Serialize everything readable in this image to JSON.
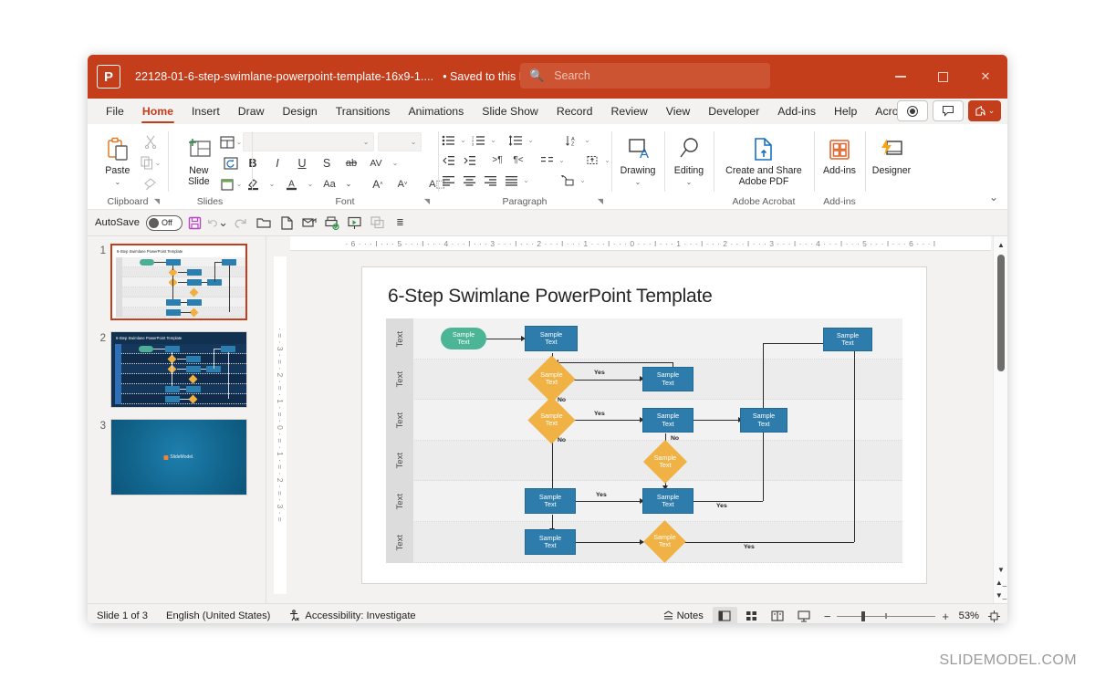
{
  "window": {
    "app_icon": "powerpoint-logo-icon",
    "document_title": "22128-01-6-step-swimlane-powerpoint-template-16x9-1....",
    "save_state": "• Saved to this PC",
    "save_state_chevron": "⌄",
    "search_placeholder": "Search",
    "search_value": "",
    "minimize_label": "–",
    "maximize_label": "□",
    "close_label": "✕"
  },
  "ribbon_tabs": [
    {
      "label": "File",
      "active": false
    },
    {
      "label": "Home",
      "active": true
    },
    {
      "label": "Insert",
      "active": false
    },
    {
      "label": "Draw",
      "active": false
    },
    {
      "label": "Design",
      "active": false
    },
    {
      "label": "Transitions",
      "active": false
    },
    {
      "label": "Animations",
      "active": false
    },
    {
      "label": "Slide Show",
      "active": false
    },
    {
      "label": "Record",
      "active": false
    },
    {
      "label": "Review",
      "active": false
    },
    {
      "label": "View",
      "active": false
    },
    {
      "label": "Developer",
      "active": false
    },
    {
      "label": "Add-ins",
      "active": false
    },
    {
      "label": "Help",
      "active": false
    },
    {
      "label": "Acrobat",
      "active": false
    }
  ],
  "tabbar_right": {
    "record_button": "⏺",
    "comments_button": "💬",
    "share_button": "Share",
    "share_chevron": "⌄"
  },
  "ribbon_groups": {
    "clipboard": {
      "label": "Clipboard",
      "paste_label": "Paste",
      "paste_chevron": "⌄",
      "cut_label": "Cut",
      "copy_label": "Copy",
      "format_painter_label": "Format Painter",
      "dialog_launcher": "⌐"
    },
    "slides": {
      "label": "Slides",
      "new_slide_label": "New Slide",
      "new_slide_chevron": "⌄",
      "layout_label": "Layout",
      "reset_label": "Reset",
      "section_label": "Section"
    },
    "font": {
      "label": "Font",
      "font_name_value": "",
      "font_size_value": "",
      "bold": "B",
      "italic": "I",
      "underline": "U",
      "shadow": "S",
      "strikethrough": "ab",
      "character_spacing": "AV",
      "text_highlight": "Highlight",
      "font_color": "A",
      "change_case": "Aa",
      "increase_size": "A",
      "decrease_size": "A",
      "clear_formatting": "A",
      "dialog_launcher": "⌐"
    },
    "paragraph": {
      "label": "Paragraph",
      "bullets": "Bullets",
      "numbering": "Numbering",
      "line_spacing": "Line Spacing",
      "text_direction": "Text Direction",
      "decrease_indent": "Decrease Indent",
      "increase_indent": "Increase Indent",
      "ltr": "Left-to-Right",
      "rtl": "Right-to-Left",
      "columns": "Columns",
      "align_text": "Align Text",
      "align_left": "Align Left",
      "align_center": "Center",
      "align_right": "Align Right",
      "justify": "Justify",
      "convert_smartart": "Convert to SmartArt",
      "dialog_launcher": "⌐"
    },
    "drawing": {
      "label": "Drawing",
      "chevron": "⌄"
    },
    "editing": {
      "label": "Editing",
      "chevron": "⌄"
    },
    "adobe_acrobat": {
      "label": "Adobe Acrobat",
      "button_line1": "Create and Share",
      "button_line2": "Adobe PDF"
    },
    "addins": {
      "label": "Add-ins",
      "addins_button": "Add-ins",
      "designer_button": "Designer",
      "collapse_ribbon": "⌄"
    }
  },
  "quick_access": {
    "autosave_label": "AutoSave",
    "autosave_state": "Off",
    "buttons": [
      "save-icon",
      "undo-icon",
      "redo-icon",
      "open-icon",
      "new-icon",
      "email-icon",
      "quick-print-icon",
      "start-slideshow-icon",
      "duplicate-icon",
      "more-icon"
    ]
  },
  "thumbnails": [
    {
      "number": "1",
      "title": "6-Step Swimlane PowerPoint Template",
      "selected": true,
      "style": "light"
    },
    {
      "number": "2",
      "title": "6-Step Swimlane PowerPoint Template",
      "selected": false,
      "style": "dark"
    },
    {
      "number": "3",
      "title": "",
      "selected": false,
      "style": "blue",
      "logo": "SlideModel."
    }
  ],
  "rulers": {
    "horizontal": "·  6 · · · I · · · 5 · · · I · · · 4 · · · I · · · 3 · · · I · · · 2 · · · I · · · 1 · · · I · · · 0 · · · I · · · 1 · · · I · · · 2 · · · I · · · 3 · · · I · · · 4 · · · I · · · 5 · · · I · · · 6 · · · I",
    "vertical": "· = · 3 · = · 2 · = · 1 · = · 0 · = · 1 · = · 2 · = · 3 · ="
  },
  "slide": {
    "title": "6-Step Swimlane PowerPoint Template",
    "lane_label": "Text",
    "lane_count": 6,
    "node_text_line1": "Sample",
    "node_text_line2": "Text",
    "edge_label_yes": "Yes",
    "edge_label_no": "No"
  },
  "chart_data": {
    "type": "diagram",
    "title": "6-Step Swimlane PowerPoint Template",
    "lanes": [
      {
        "label": "Text",
        "nodes": [
          {
            "id": "start",
            "shape": "oval",
            "text": "Sample Text",
            "color": "#4cb596"
          },
          {
            "id": "p1",
            "shape": "rect",
            "text": "Sample Text",
            "color": "#2e7cab"
          },
          {
            "id": "end",
            "shape": "rect",
            "text": "Sample Text",
            "color": "#2e7cab"
          }
        ]
      },
      {
        "label": "Text",
        "nodes": [
          {
            "id": "d1",
            "shape": "diamond",
            "text": "Sample Text",
            "color": "#f0b244"
          },
          {
            "id": "p2",
            "shape": "rect",
            "text": "Sample Text",
            "color": "#2e7cab"
          }
        ]
      },
      {
        "label": "Text",
        "nodes": [
          {
            "id": "d2",
            "shape": "diamond",
            "text": "Sample Text",
            "color": "#f0b244"
          },
          {
            "id": "p3",
            "shape": "rect",
            "text": "Sample Text",
            "color": "#2e7cab"
          },
          {
            "id": "p4",
            "shape": "rect",
            "text": "Sample Text",
            "color": "#2e7cab"
          }
        ]
      },
      {
        "label": "Text",
        "nodes": [
          {
            "id": "d3",
            "shape": "diamond",
            "text": "Sample Text",
            "color": "#f0b244"
          }
        ]
      },
      {
        "label": "Text",
        "nodes": [
          {
            "id": "p5",
            "shape": "rect",
            "text": "Sample Text",
            "color": "#2e7cab"
          },
          {
            "id": "p6",
            "shape": "rect",
            "text": "Sample Text",
            "color": "#2e7cab"
          }
        ]
      },
      {
        "label": "Text",
        "nodes": [
          {
            "id": "p7",
            "shape": "rect",
            "text": "Sample Text",
            "color": "#2e7cab"
          },
          {
            "id": "d4",
            "shape": "diamond",
            "text": "Sample Text",
            "color": "#f0b244"
          }
        ]
      }
    ],
    "edges": [
      {
        "from": "start",
        "to": "p1",
        "label": ""
      },
      {
        "from": "p1",
        "to": "d1",
        "label": ""
      },
      {
        "from": "d1",
        "to": "p2",
        "label": "Yes"
      },
      {
        "from": "d1",
        "to": "d2",
        "label": "No"
      },
      {
        "from": "p2",
        "to": "p1",
        "label": ""
      },
      {
        "from": "d2",
        "to": "p3",
        "label": "Yes"
      },
      {
        "from": "d2",
        "to": "p5",
        "label": "No"
      },
      {
        "from": "p3",
        "to": "p4",
        "label": ""
      },
      {
        "from": "p3",
        "to": "d3",
        "label": "No"
      },
      {
        "from": "p4",
        "to": "end",
        "label": ""
      },
      {
        "from": "d3",
        "to": "p6",
        "label": ""
      },
      {
        "from": "p5",
        "to": "p6",
        "label": "Yes"
      },
      {
        "from": "p5",
        "to": "p7",
        "label": ""
      },
      {
        "from": "p6",
        "to": "p4",
        "label": "Yes"
      },
      {
        "from": "p7",
        "to": "d4",
        "label": ""
      },
      {
        "from": "d4",
        "to": "end",
        "label": "Yes"
      }
    ],
    "colors": {
      "process": "#2e7cab",
      "decision": "#f0b244",
      "start": "#4cb596",
      "lane_bg": "#f2f2f2",
      "lane_header": "#dcdcdc"
    }
  },
  "status_bar": {
    "slide_counter": "Slide 1 of 3",
    "language": "English (United States)",
    "accessibility": "Accessibility: Investigate",
    "notes_label": "Notes",
    "view_normal": "normal-view-icon",
    "view_sorter": "slide-sorter-icon",
    "view_reading": "reading-view-icon",
    "view_slideshow": "slideshow-icon",
    "zoom_out": "−",
    "zoom_in": "+",
    "zoom_level": "53%",
    "fit_slide": "fit-to-window-icon"
  },
  "footer": {
    "brand": "SLIDEMODEL.COM"
  },
  "colors": {
    "accent": "#c43e1c",
    "titlebar": "#c43e1c",
    "ribbon_bg": "#ffffff",
    "chrome_bg": "#f3f2f1"
  }
}
